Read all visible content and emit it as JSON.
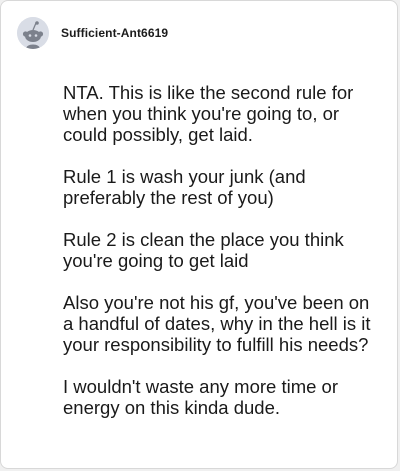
{
  "comment": {
    "username": "Sufficient-Ant6619",
    "avatar_icon": "reddit-snoo-icon",
    "paragraphs": [
      "NTA. This is like the second rule for when you think you're going to, or could possibly, get laid.",
      "Rule 1 is wash your junk (and preferably the rest of you)",
      "Rule 2 is clean the place you think you're going to get laid",
      "Also you're not his gf, you've been on a handful of dates, why in the hell is it your responsibility to fulfill his needs?",
      "I wouldn't waste any more time or energy on this kinda dude."
    ]
  },
  "colors": {
    "background": "#f0f0f0",
    "card": "#ffffff",
    "text": "#1a1a1a",
    "avatar_bg": "#d9dde6"
  }
}
